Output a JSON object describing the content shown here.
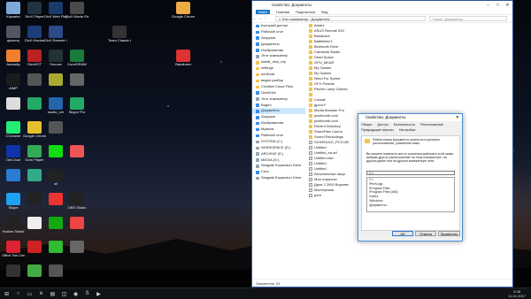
{
  "desktop": {
    "icons": [
      {
        "label": "Корзина",
        "color": "#7fa8d8",
        "col": 0,
        "row": 0
      },
      {
        "label": "qiukerry",
        "color": "#556",
        "col": 0,
        "row": 1
      },
      {
        "label": "Audacity",
        "color": "#f07f2f",
        "col": 0,
        "row": 2
      },
      {
        "label": "AIMP",
        "color": "#1b1b1b",
        "col": 0,
        "row": 3
      },
      {
        "label": "",
        "color": "#ddd",
        "col": 0,
        "row": 4
      },
      {
        "label": "CCleaner",
        "color": "#2e7",
        "col": 0,
        "row": 5
      },
      {
        "label": "DeLOcal",
        "color": "#13a",
        "col": 0,
        "row": 6
      },
      {
        "label": "",
        "color": "#2a7bd2",
        "col": 0,
        "row": 7
      },
      {
        "label": "Skype",
        "color": "#1da1f2",
        "col": 0,
        "row": 8
      },
      {
        "label": "Hotline Shield",
        "color": "#222",
        "col": 0,
        "row": 9
      },
      {
        "label": "Office Tab Center",
        "color": "#d23",
        "col": 0,
        "row": 10
      },
      {
        "label": "",
        "color": "#333",
        "col": 0,
        "row": 11
      },
      {
        "label": "DivX Player",
        "color": "#234",
        "col": 1,
        "row": 0
      },
      {
        "label": "DivX Movies",
        "color": "#1c3c7a",
        "col": 1,
        "row": 1
      },
      {
        "label": "GeoHOT",
        "color": "#b22",
        "col": 1,
        "row": 2
      },
      {
        "label": "",
        "color": "#555",
        "col": 1,
        "row": 3
      },
      {
        "label": "",
        "color": "#2a6",
        "col": 1,
        "row": 4
      },
      {
        "label": "Google Chrome",
        "color": "#e4c12b",
        "col": 1,
        "row": 5
      },
      {
        "label": "Gom Player",
        "color": "#3a5",
        "col": 1,
        "row": 6
      },
      {
        "label": "",
        "color": "#3a8",
        "col": 1,
        "row": 7
      },
      {
        "label": "",
        "color": "#222",
        "col": 1,
        "row": 8
      },
      {
        "label": "",
        "color": "#eee",
        "col": 1,
        "row": 9
      },
      {
        "label": "",
        "color": "#c22",
        "col": 1,
        "row": 10
      },
      {
        "label": "",
        "color": "#4a4",
        "col": 1,
        "row": 11
      },
      {
        "label": "DivX Web Player",
        "color": "#1b3b6a",
        "col": 2,
        "row": 0
      },
      {
        "label": "DivX Remote IDO",
        "color": "#2b4b8a",
        "col": 2,
        "row": 1
      },
      {
        "label": "Snooze",
        "color": "#233",
        "col": 2,
        "row": 2
      },
      {
        "label": "",
        "color": "#aa3",
        "col": 2,
        "row": 3
      },
      {
        "label": "studio_ver",
        "color": "#26a",
        "col": 2,
        "row": 4
      },
      {
        "label": "",
        "color": "#555",
        "col": 2,
        "row": 5
      },
      {
        "label": "",
        "color": "#1d1",
        "col": 2,
        "row": 6
      },
      {
        "label": "oil",
        "color": "#222",
        "col": 2,
        "row": 7
      },
      {
        "label": "",
        "color": "#e33",
        "col": 2,
        "row": 8
      },
      {
        "label": "",
        "color": "#1a1",
        "col": 2,
        "row": 9
      },
      {
        "label": "",
        "color": "#3b3",
        "col": 2,
        "row": 10
      },
      {
        "label": "",
        "color": "#555",
        "col": 2,
        "row": 11
      },
      {
        "label": "DivX Movie Editing",
        "color": "#4a4a4a",
        "col": 3,
        "row": 0
      },
      {
        "label": "CorelDRAW",
        "color": "#1a7a3a",
        "col": 3,
        "row": 2
      },
      {
        "label": "",
        "color": "#666",
        "col": 3,
        "row": 3
      },
      {
        "label": "Skype Pro",
        "color": "#2a6",
        "col": 3,
        "row": 4
      },
      {
        "label": "",
        "color": "#e55",
        "col": 3,
        "row": 6
      },
      {
        "label": "OBS Studio",
        "color": "#222",
        "col": 3,
        "row": 8
      },
      {
        "label": "",
        "color": "#e44",
        "col": 3,
        "row": 9
      },
      {
        "label": "",
        "color": "#666",
        "col": 3,
        "row": 10
      },
      {
        "label": "Bandicam",
        "color": "#d33",
        "col": 8,
        "row": 2
      },
      {
        "label": "Google Chrome",
        "color": "#ea4",
        "col": 8,
        "row": 0
      },
      {
        "label": "Team Classic Alsace Nero",
        "color": "#333",
        "col": 5,
        "row": 1
      }
    ]
  },
  "taskbar": {
    "clock_time": "5:38",
    "clock_date": "11.01.2017"
  },
  "explorer": {
    "title": "Свойства: Документы",
    "ribbon_tabs": [
      "Файл",
      "Главная",
      "Поделиться",
      "Вид"
    ],
    "address": "« Этот компьютер › Документы",
    "search_placeholder": "Поиск: Документы",
    "nav_items": [
      {
        "label": "Быстрый доступ",
        "icon": "blue"
      },
      {
        "label": "Рабочий стол",
        "icon": "blue"
      },
      {
        "label": "Загрузки",
        "icon": "blue"
      },
      {
        "label": "Документы",
        "icon": "blue"
      },
      {
        "label": "Изображения",
        "icon": "blue"
      },
      {
        "label": "Этот компьютер",
        "icon": "gray"
      },
      {
        "label": "install_oboi_rep",
        "icon": "yellow"
      },
      {
        "label": "settings",
        "icon": "yellow"
      },
      {
        "label": "sunflurai",
        "icon": "yellow"
      },
      {
        "label": "видео разбор",
        "icon": "yellow"
      },
      {
        "label": "Creative Cloud Files",
        "icon": "yellow"
      },
      {
        "label": "OneDrive",
        "icon": "blue"
      },
      {
        "label": "Этот компьютер",
        "icon": "gray"
      },
      {
        "label": "Видео",
        "icon": "blue"
      },
      {
        "label": "Документы",
        "icon": "blue",
        "selected": true
      },
      {
        "label": "Загрузки",
        "icon": "blue"
      },
      {
        "label": "Изображения",
        "icon": "blue"
      },
      {
        "label": "Музыка",
        "icon": "blue"
      },
      {
        "label": "Рабочий стол",
        "icon": "blue"
      },
      {
        "label": "SYSTEM (C:)",
        "icon": "gray"
      },
      {
        "label": "WORKSPACE (D:)",
        "icon": "gray"
      },
      {
        "label": "ARCHIVE (E:)",
        "icon": "gray"
      },
      {
        "label": "MEDIA (G:)",
        "icon": "gray"
      },
      {
        "label": "Seagate Expansion Drive",
        "icon": "gray"
      },
      {
        "label": "Сеть",
        "icon": "blue"
      },
      {
        "label": "Seagate Expansion Drive",
        "icon": "gray"
      }
    ],
    "files": [
      {
        "name": "Adobe",
        "doc": false
      },
      {
        "name": "ASUS Remote IDO",
        "doc": false
      },
      {
        "name": "Bandicam",
        "doc": false
      },
      {
        "name": "Battlefield 1",
        "doc": false
      },
      {
        "name": "Bluetooth Drive",
        "doc": false
      },
      {
        "name": "Camtasia Studio",
        "doc": false
      },
      {
        "name": "Dead Space",
        "doc": false
      },
      {
        "name": "GPU_MKAR",
        "doc": false
      },
      {
        "name": "My Games",
        "doc": false
      },
      {
        "name": "My Games",
        "doc": false
      },
      {
        "name": "Need For Speed",
        "doc": false
      },
      {
        "name": "OFX Presets",
        "doc": false
      },
      {
        "name": "Pitcher Lamp Games",
        "doc": false
      },
      {
        "name": "",
        "doc": false
      },
      {
        "name": "Corsair",
        "doc": false
      },
      {
        "name": "gpcm-F",
        "doc": false
      },
      {
        "name": "Media Browser Pro",
        "doc": false
      },
      {
        "name": "pixelbomb.com",
        "doc": false
      },
      {
        "name": "pixelbomb.com",
        "doc": false
      },
      {
        "name": "Recent Directory",
        "doc": false
      },
      {
        "name": "ShareFiles Cache",
        "doc": false
      },
      {
        "name": "Sound Recordings",
        "doc": false
      },
      {
        "name": "SCHEDULE_PCS.DB",
        "doc": true
      },
      {
        "name": "Untitled",
        "doc": true
      },
      {
        "name": "Untitled_srt.srf",
        "doc": true
      },
      {
        "name": "Untitled.xlsx",
        "doc": true
      },
      {
        "name": "Untitled",
        "doc": true
      },
      {
        "name": "Untitled",
        "doc": true
      },
      {
        "name": "Бесконечные лица",
        "doc": true
      },
      {
        "name": "Мои открытки",
        "doc": true
      },
      {
        "name": "Дрон 2 2000 Воркнес",
        "doc": true
      },
      {
        "name": "Мастерская",
        "doc": true
      },
      {
        "name": "print",
        "doc": true
      }
    ],
    "status": "Элементов: 33"
  },
  "dialog": {
    "title": "Свойства: Документы",
    "close": "✕",
    "tabs": [
      "Общие",
      "Доступ",
      "Безопасность",
      "Расположение",
      "Предыдущие версии",
      "Настройка"
    ],
    "intro": "Файлы папки Документы хранятся в целевом расположении, указанном ниже.",
    "text2": "Вы можете изменить место хранения файлов в этой папке, выбрав другое расположение на этом компьютере, на другом диске или на другом компьютере сети.",
    "path": "C:\\",
    "list": [
      "C:\\",
      "\\PerfLogs",
      "\\Program Files",
      "\\Program Files (x86)",
      "\\Users",
      "\\Windows",
      "\\Документы"
    ],
    "buttons": {
      "ok": "ОК",
      "cancel": "Отмена",
      "apply": "Применить"
    }
  }
}
